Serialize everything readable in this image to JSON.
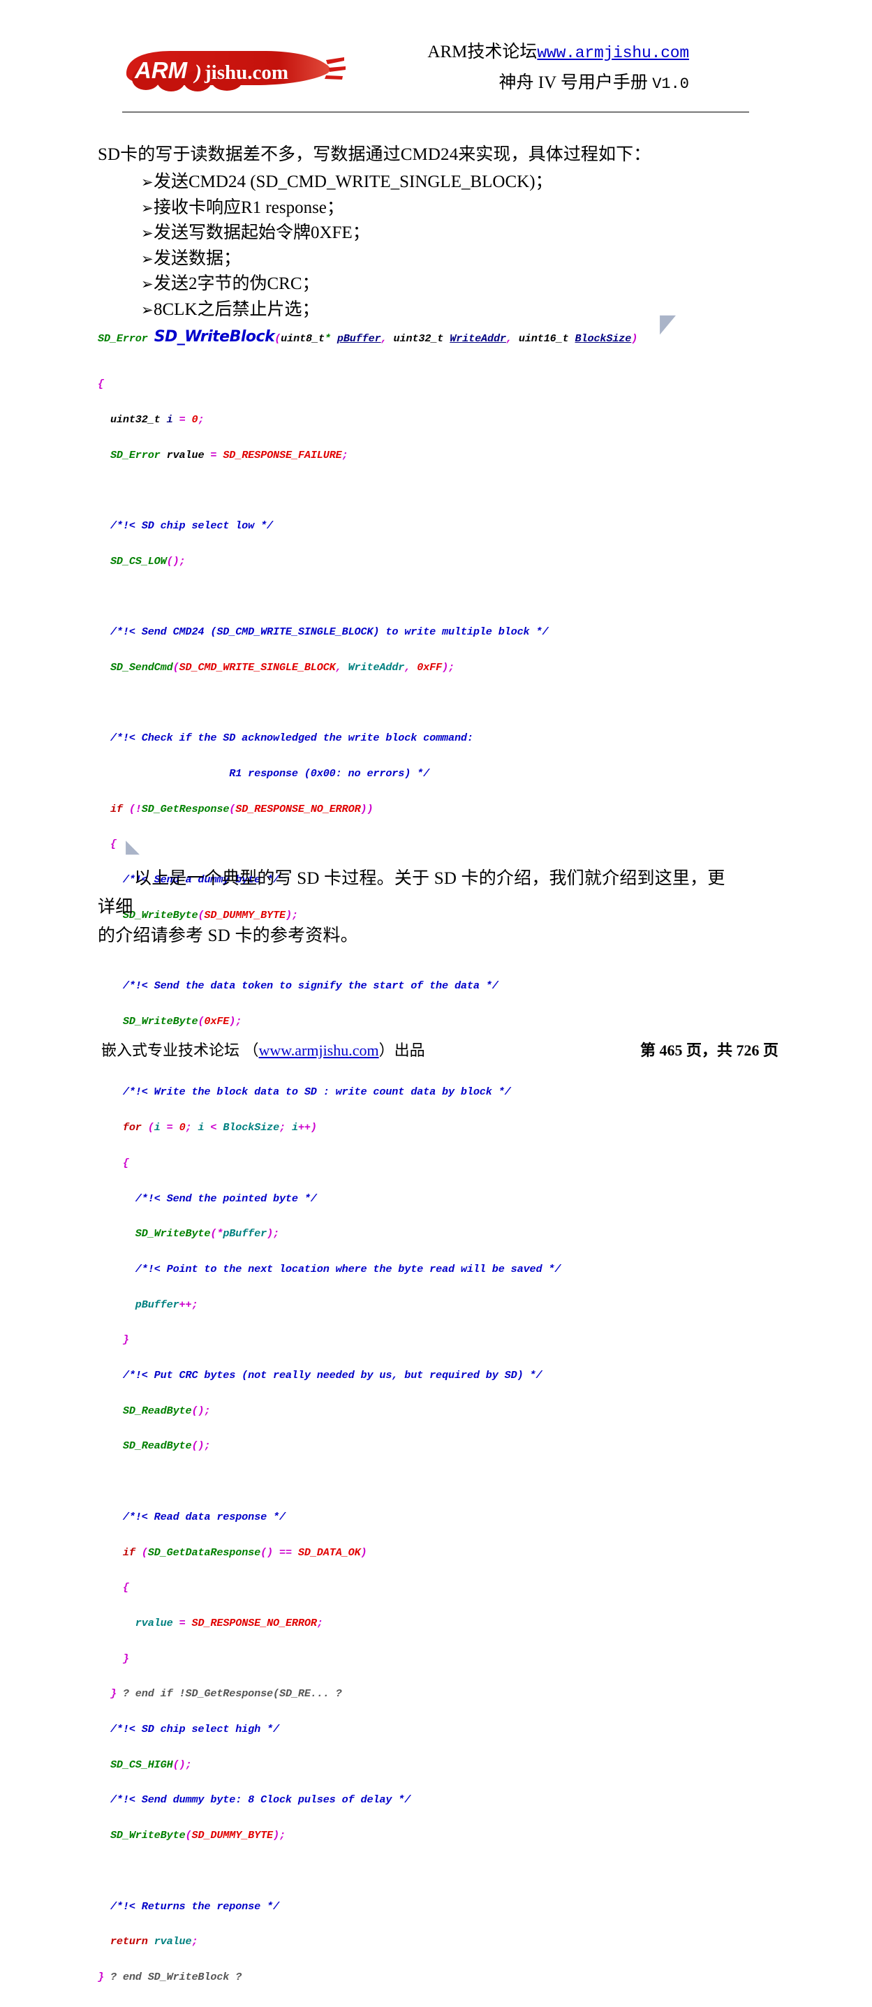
{
  "header": {
    "logo_text": "ARM jishu.com",
    "line1_prefix": "ARM技术论坛",
    "line1_url": "www.armjishu.com",
    "line2": "神舟 IV 号用户手册",
    "line2_version": "V1.0"
  },
  "body": {
    "intro": "SD卡的写于读数据差不多，写数据通过CMD24来实现，具体过程如下：",
    "bullet_marker": "➢",
    "bullets": [
      "发送CMD24 (SD_CMD_WRITE_SINGLE_BLOCK)；",
      "接收卡响应R1 response；",
      "发送写数据起始令牌0XFE；",
      "发送数据；",
      "发送2字节的伪CRC；",
      "8CLK之后禁止片选；"
    ]
  },
  "code": {
    "return_type": "SD_Error",
    "function_name": "SD_WriteBlock",
    "signature_params": "(uint8_t* pBuffer, uint32_t WriteAddr, uint16_t BlockSize)",
    "lines": [
      "{",
      "  uint32_t i = 0;",
      "  SD_Error rvalue = SD_RESPONSE_FAILURE;",
      "",
      "  /*!< SD chip select low */",
      "  SD_CS_LOW();",
      "",
      "  /*!< Send CMD24 (SD_CMD_WRITE_SINGLE_BLOCK) to write multiple block */",
      "  SD_SendCmd(SD_CMD_WRITE_SINGLE_BLOCK, WriteAddr, 0xFF);",
      "",
      "  /*!< Check if the SD acknowledged the write block command:",
      "                     R1 response (0x00: no errors) */",
      "  if (!SD_GetResponse(SD_RESPONSE_NO_ERROR))",
      "  {",
      "    /*!< Send a dummy byte */",
      "    SD_WriteByte(SD_DUMMY_BYTE);",
      "",
      "    /*!< Send the data token to signify the start of the data */",
      "    SD_WriteByte(0xFE);",
      "",
      "    /*!< Write the block data to SD : write count data by block */",
      "    for (i = 0; i < BlockSize; i++)",
      "    {",
      "      /*!< Send the pointed byte */",
      "      SD_WriteByte(*pBuffer);",
      "      /*!< Point to the next location where the byte read will be saved */",
      "      pBuffer++;",
      "    }",
      "    /*!< Put CRC bytes (not really needed by us, but required by SD) */",
      "    SD_ReadByte();",
      "    SD_ReadByte();",
      "",
      "    /*!< Read data response */",
      "    if (SD_GetDataResponse() == SD_DATA_OK)",
      "    {",
      "      rvalue = SD_RESPONSE_NO_ERROR;",
      "    }",
      "  } ? end if !SD_GetResponse(SD_RE... ?",
      "  /*!< SD chip select high */",
      "  SD_CS_HIGH();",
      "  /*!< Send dummy byte: 8 Clock pulses of delay */",
      "  SD_WriteByte(SD_DUMMY_BYTE);",
      "",
      "  /*!< Returns the reponse */",
      "  return rvalue;",
      "} ? end SD_WriteBlock ?"
    ]
  },
  "closing": {
    "line1": "以上是一个典型的写 SD 卡过程。关于 SD 卡的介绍，我们就介绍到这里，更详细",
    "line2": "的介绍请参考 SD 卡的参考资料。"
  },
  "footer": {
    "left_prefix": "嵌入式专业技术论坛 （",
    "left_link": "www.armjishu.com",
    "left_suffix": "）出品",
    "page_label_prefix": "第",
    "page_number": "465",
    "page_label_mid": "页，共",
    "page_total": "726",
    "page_label_suffix": "页"
  },
  "colors": {
    "link": "#0000cc",
    "logo_red": "#cc1111",
    "code_comment": "#0000c8",
    "code_keyword": "#c00000",
    "code_type": "#008000",
    "code_macro": "#e00000",
    "code_punct": "#cc00cc",
    "code_var": "#008080"
  }
}
